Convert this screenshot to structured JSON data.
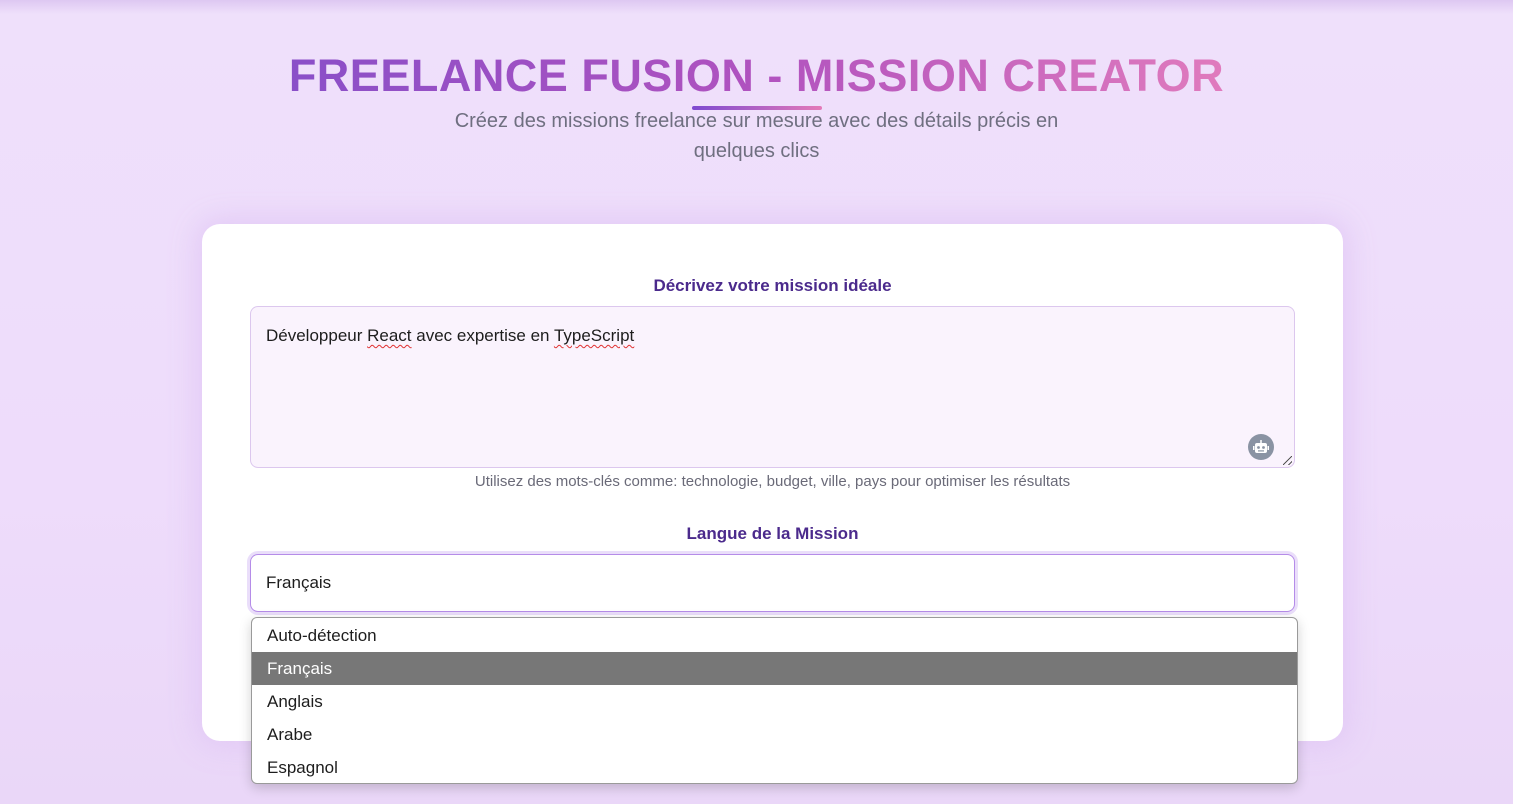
{
  "header": {
    "title": "FREELANCE FUSION - MISSION CREATOR",
    "subtitle": "Créez des missions freelance sur mesure avec des détails précis en quelques clics"
  },
  "form": {
    "mission_label": "Décrivez votre mission idéale",
    "mission_text": {
      "part1": "Développeur ",
      "part2": "React",
      "part3": " avec expertise en ",
      "part4": "TypeScript"
    },
    "ai_icon": "robot-icon",
    "hint": "Utilisez des mots-clés comme: technologie, budget, ville, pays pour optimiser les résultats",
    "language_label": "Langue de la Mission",
    "language_selected": "Français"
  },
  "dropdown": {
    "options": [
      "Auto-détection",
      "Français",
      "Anglais",
      "Arabe",
      "Espagnol"
    ],
    "selected_index": 1
  },
  "colors": {
    "title_gradient_start": "#8a4fc8",
    "title_gradient_end": "#e07bbd",
    "label": "#4b2a8c",
    "selected_option_bg": "#777777"
  }
}
